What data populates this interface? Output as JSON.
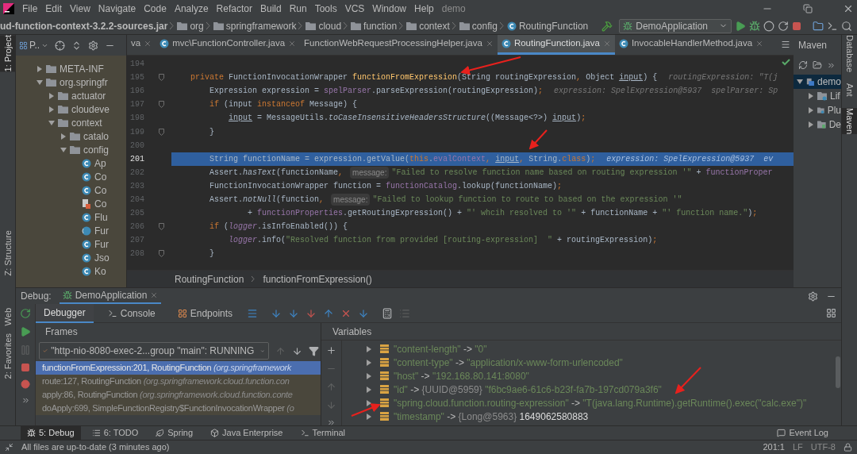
{
  "menu": {
    "items": [
      "File",
      "Edit",
      "View",
      "Navigate",
      "Code",
      "Analyze",
      "Refactor",
      "Build",
      "Run",
      "Tools",
      "VCS",
      "Window",
      "Help"
    ],
    "project": "demo"
  },
  "navbar": {
    "crumbs": [
      {
        "label": "ud-function-context-3.2.2-sources.jar",
        "kind": "jar"
      },
      {
        "label": "org",
        "kind": "folder"
      },
      {
        "label": "springframework",
        "kind": "folder"
      },
      {
        "label": "cloud",
        "kind": "folder"
      },
      {
        "label": "function",
        "kind": "folder"
      },
      {
        "label": "context",
        "kind": "folder"
      },
      {
        "label": "config",
        "kind": "folder"
      },
      {
        "label": "RoutingFunction",
        "kind": "class"
      }
    ],
    "run_config": "DemoApplication"
  },
  "left_strip": [
    {
      "label": "1: Project",
      "selected": true
    },
    {
      "label": "Z: Structure",
      "selected": false
    },
    {
      "label": "Web",
      "selected": false
    },
    {
      "label": "2: Favorites",
      "selected": false
    }
  ],
  "right_strip": [
    {
      "label": "Database",
      "selected": false
    },
    {
      "label": "Ant",
      "selected": false
    },
    {
      "label": "Maven",
      "selected": true
    }
  ],
  "project": {
    "title": "P..",
    "tree": [
      {
        "label": "META-INF",
        "kind": "folder",
        "expanded": false
      },
      {
        "label": "org.springfr",
        "kind": "folder",
        "expanded": true,
        "children": [
          {
            "label": "actuator",
            "kind": "folder",
            "expanded": false
          },
          {
            "label": "cloudeve",
            "kind": "folder",
            "expanded": false
          },
          {
            "label": "context",
            "kind": "folder",
            "expanded": true,
            "children": [
              {
                "label": "catalo",
                "kind": "folder",
                "expanded": false
              },
              {
                "label": "config",
                "kind": "folder",
                "expanded": true,
                "children": [
                  {
                    "label": "Ap",
                    "kind": "class"
                  },
                  {
                    "label": "Co",
                    "kind": "class"
                  },
                  {
                    "label": "Co",
                    "kind": "class"
                  },
                  {
                    "label": "Co",
                    "kind": "resource"
                  },
                  {
                    "label": "Flu",
                    "kind": "class"
                  },
                  {
                    "label": "Fur",
                    "kind": "function"
                  },
                  {
                    "label": "Fur",
                    "kind": "class"
                  },
                  {
                    "label": "Jso",
                    "kind": "class"
                  },
                  {
                    "label": "Ko",
                    "kind": "class"
                  }
                ]
              }
            ]
          }
        ]
      }
    ]
  },
  "editor": {
    "tabs": [
      {
        "label": "va",
        "selected": false,
        "icon": false
      },
      {
        "label": "mvc\\FunctionController.java",
        "selected": false,
        "icon": true
      },
      {
        "label": "FunctionWebRequestProcessingHelper.java",
        "selected": false,
        "icon": false
      },
      {
        "label": "RoutingFunction.java",
        "selected": true,
        "icon": true
      },
      {
        "label": "InvocableHandlerMethod.java",
        "selected": false,
        "icon": true
      }
    ],
    "lines": [
      {
        "number": "194",
        "fold": false,
        "current": false
      },
      {
        "number": "195",
        "fold": true,
        "current": false,
        "tokens": [
          {
            "text": "    private ",
            "kind": "kw"
          },
          {
            "text": "FunctionInvocationWrapper ",
            "kind": "plain"
          },
          {
            "text": "functionFromExpression",
            "kind": "method"
          },
          {
            "text": "(String routingExpression",
            "kind": "plain"
          },
          {
            "text": ", ",
            "kind": "kw"
          },
          {
            "text": "Object ",
            "kind": "plain"
          },
          {
            "text": "input",
            "kind": "under"
          },
          {
            "text": ") {",
            "kind": "plain"
          },
          {
            "text": "routingExpression: \"T(j",
            "kind": "hint"
          }
        ]
      },
      {
        "number": "196",
        "fold": false,
        "current": false,
        "tokens": [
          {
            "text": "        Expression expression = ",
            "kind": "plain"
          },
          {
            "text": "spelParser",
            "kind": "field"
          },
          {
            "text": ".parseExpression(routingExpression)",
            "kind": "plain"
          },
          {
            "text": ";",
            "kind": "kw"
          },
          {
            "text": "expression: SpelExpression@5937  spelParser: Sp",
            "kind": "hint"
          }
        ]
      },
      {
        "number": "197",
        "fold": true,
        "current": false,
        "tokens": [
          {
            "text": "        if ",
            "kind": "kw"
          },
          {
            "text": "(input ",
            "kind": "plain"
          },
          {
            "text": "instanceof ",
            "kind": "kw"
          },
          {
            "text": "Message) {",
            "kind": "plain"
          }
        ]
      },
      {
        "number": "198",
        "fold": false,
        "current": false,
        "tokens": [
          {
            "text": "            input",
            "kind": "under"
          },
          {
            "text": " = MessageUtils.",
            "kind": "plain"
          },
          {
            "text": "toCaseInsensitiveHeadersStructure",
            "kind": "italic"
          },
          {
            "text": "((Message<?>) ",
            "kind": "plain"
          },
          {
            "text": "input",
            "kind": "under"
          },
          {
            "text": ")",
            "kind": "plain"
          },
          {
            "text": ";",
            "kind": "kw"
          }
        ]
      },
      {
        "number": "199",
        "fold": true,
        "current": false,
        "tokens": [
          {
            "text": "        }",
            "kind": "plain"
          }
        ]
      },
      {
        "number": "200",
        "fold": false,
        "current": false
      },
      {
        "number": "201",
        "fold": false,
        "current": true,
        "tokens": [
          {
            "text": "        String functionName = expression.getValue(",
            "kind": "plain"
          },
          {
            "text": "this",
            "kind": "kw"
          },
          {
            "text": ".",
            "kind": "plain"
          },
          {
            "text": "evalContext",
            "kind": "field"
          },
          {
            "text": ", ",
            "kind": "kw"
          },
          {
            "text": "input",
            "kind": "under"
          },
          {
            "text": ", ",
            "kind": "kw"
          },
          {
            "text": "String.",
            "kind": "plain"
          },
          {
            "text": "class",
            "kind": "kw"
          },
          {
            "text": ")",
            "kind": "plain"
          },
          {
            "text": ";",
            "kind": "kw"
          },
          {
            "text": "expression: SpelExpression@5937  ev",
            "kind": "hint"
          }
        ]
      },
      {
        "number": "202",
        "fold": false,
        "current": false,
        "tokens": [
          {
            "text": "        Assert.",
            "kind": "plain"
          },
          {
            "text": "hasText",
            "kind": "italic"
          },
          {
            "text": "(functionName",
            "kind": "plain"
          },
          {
            "text": ", ",
            "kind": "kw"
          },
          {
            "text": "message:",
            "kind": "inlay"
          },
          {
            "text": "\"Failed to resolve function name based on routing expression '\"",
            "kind": "string"
          },
          {
            "text": " + ",
            "kind": "plain"
          },
          {
            "text": "functionProper",
            "kind": "field"
          }
        ]
      },
      {
        "number": "203",
        "fold": false,
        "current": false,
        "tokens": [
          {
            "text": "        FunctionInvocationWrapper function = ",
            "kind": "plain"
          },
          {
            "text": "functionCatalog",
            "kind": "field"
          },
          {
            "text": ".lookup(functionName)",
            "kind": "plain"
          },
          {
            "text": ";",
            "kind": "kw"
          }
        ]
      },
      {
        "number": "204",
        "fold": false,
        "current": false,
        "tokens": [
          {
            "text": "        Assert.",
            "kind": "plain"
          },
          {
            "text": "notNull",
            "kind": "italic"
          },
          {
            "text": "(function",
            "kind": "plain"
          },
          {
            "text": ", ",
            "kind": "kw"
          },
          {
            "text": "message:",
            "kind": "inlay"
          },
          {
            "text": "\"Failed to lookup function to route to based on the expression '\"",
            "kind": "string"
          }
        ]
      },
      {
        "number": "205",
        "fold": false,
        "current": false,
        "tokens": [
          {
            "text": "                + ",
            "kind": "plain"
          },
          {
            "text": "functionProperties",
            "kind": "field"
          },
          {
            "text": ".getRoutingExpression() + ",
            "kind": "plain"
          },
          {
            "text": "\"' whcih resolved to '\"",
            "kind": "string"
          },
          {
            "text": " + functionName + ",
            "kind": "plain"
          },
          {
            "text": "\"' function name.\"",
            "kind": "string"
          },
          {
            "text": ")",
            "kind": "plain"
          },
          {
            "text": ";",
            "kind": "kw"
          }
        ]
      },
      {
        "number": "206",
        "fold": true,
        "current": false,
        "tokens": [
          {
            "text": "        if ",
            "kind": "kw"
          },
          {
            "text": "(",
            "kind": "plain"
          },
          {
            "text": "logger",
            "kind": "field_italic"
          },
          {
            "text": ".isInfoEnabled()) {",
            "kind": "plain"
          }
        ]
      },
      {
        "number": "207",
        "fold": false,
        "current": false,
        "tokens": [
          {
            "text": "            logger",
            "kind": "field_italic"
          },
          {
            "text": ".info(",
            "kind": "plain"
          },
          {
            "text": "\"Resolved function from provided [routing-expression]  \"",
            "kind": "string"
          },
          {
            "text": " + routingExpression)",
            "kind": "plain"
          },
          {
            "text": ";",
            "kind": "kw"
          }
        ]
      },
      {
        "number": "208",
        "fold": true,
        "current": false,
        "tokens": [
          {
            "text": "        }",
            "kind": "plain"
          }
        ]
      }
    ],
    "breadcrumb": [
      "RoutingFunction",
      "functionFromExpression()"
    ]
  },
  "maven": {
    "title": "Maven",
    "tree": [
      {
        "label": "demo",
        "selected": true,
        "expanded": true,
        "children": [
          {
            "label": "Lif",
            "kind": "lifecycle",
            "expanded": false
          },
          {
            "label": "Plu",
            "kind": "plugins",
            "expanded": false
          },
          {
            "label": "De",
            "kind": "dependencies",
            "expanded": false
          }
        ]
      }
    ]
  },
  "debug": {
    "title": "Debug:",
    "session": "DemoApplication",
    "tabs": [
      {
        "label": "Debugger",
        "selected": true
      },
      {
        "label": "Console",
        "selected": false
      },
      {
        "label": "Endpoints",
        "selected": false
      }
    ],
    "frames_title": "Frames",
    "thread": "\"http-nio-8080-exec-2...group \"main\": RUNNING",
    "frames": [
      {
        "method": "functionFromExpression:201, RoutingFunction",
        "location": "(org.springframework",
        "selected": true,
        "library": false
      },
      {
        "method": "route:127, RoutingFunction",
        "location": "(org.springframework.cloud.function.con",
        "selected": false,
        "library": true
      },
      {
        "method": "apply:86, RoutingFunction",
        "location": "(org.springframework.cloud.function.conte",
        "selected": false,
        "library": true
      },
      {
        "method": "doApply:699, SimpleFunctionRegistry$FunctionInvocationWrapper",
        "location": "(o",
        "selected": false,
        "library": true
      }
    ],
    "variables_title": "Variables",
    "variables": [
      {
        "key": "\"content-length\"",
        "arrow": "->",
        "value": "\"0\"",
        "kind": "string"
      },
      {
        "key": "\"content-type\"",
        "arrow": "->",
        "value": "\"application/x-www-form-urlencoded\"",
        "kind": "string"
      },
      {
        "key": "\"host\"",
        "arrow": "->",
        "value": "\"192.168.80.141:8080\"",
        "kind": "string"
      },
      {
        "key": "\"id\"",
        "arrow": "->",
        "type": "{UUID@5959}",
        "value": "\"f6bc9ae6-61c6-b23f-fa7b-197cd079a3f6\"",
        "kind": "object"
      },
      {
        "key": "\"spring.cloud.function.routing-expression\"",
        "arrow": "->",
        "value": "\"T(java.lang.Runtime).getRuntime().exec(\"calc.exe\")\"",
        "kind": "string"
      },
      {
        "key": "\"timestamp\"",
        "arrow": "->",
        "type": "{Long@5963}",
        "value": "1649062580883",
        "kind": "object"
      }
    ]
  },
  "tool_windows": [
    {
      "label": "5: Debug",
      "selected": true
    },
    {
      "label": "6: TODO",
      "selected": false
    },
    {
      "label": "Spring",
      "selected": false
    },
    {
      "label": "Java Enterprise",
      "selected": false
    },
    {
      "label": "Terminal",
      "selected": false
    }
  ],
  "event_log": "Event Log",
  "status": {
    "message": "All files are up-to-date (3 minutes ago)",
    "position": "201:1",
    "line_separator": "LF",
    "encoding": "UTF-8"
  }
}
